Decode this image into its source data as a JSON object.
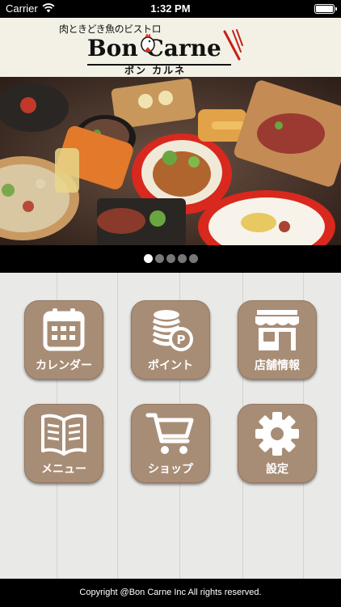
{
  "status_bar": {
    "carrier": "Carrier",
    "time": "1:32 PM",
    "icons": [
      "wifi-icon",
      "battery-icon"
    ]
  },
  "header": {
    "logo_tagline": "肉ときどき魚のビストロ",
    "logo_name": "Bon Carne",
    "logo_kana": "ボン カルネ"
  },
  "banner": {
    "slide_count": 5,
    "active_slide": 1
  },
  "menu_tiles": [
    {
      "label": "カレンダー",
      "icon": "calendar-icon"
    },
    {
      "label": "ポイント",
      "icon": "points-coins-icon"
    },
    {
      "label": "店舗情報",
      "icon": "storefront-icon"
    },
    {
      "label": "メニュー",
      "icon": "book-icon"
    },
    {
      "label": "ショップ",
      "icon": "shopping-cart-icon"
    },
    {
      "label": "設定",
      "icon": "gear-icon"
    }
  ],
  "footer": {
    "copyright": "Copyright @Bon Carne Inc All rights reserved."
  },
  "colors": {
    "tile": "#a88d76",
    "header_bg": "#f3f1e6",
    "background": "#e9e9e7"
  }
}
